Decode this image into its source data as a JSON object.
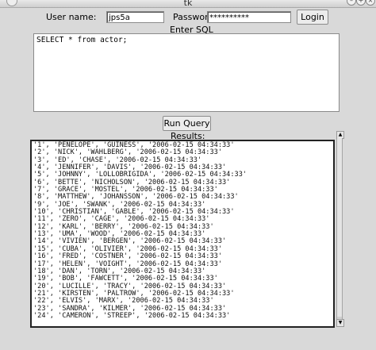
{
  "window": {
    "title": "tk"
  },
  "login": {
    "user_label": "User name:",
    "user_value": "jps5a",
    "password_label": "Password:",
    "password_value": "**********",
    "login_button": "Login"
  },
  "sql": {
    "label": "Enter SQL",
    "query": "SELECT * from actor;",
    "run_button": "Run Query"
  },
  "results": {
    "label": "Results:",
    "rows": [
      "'1', 'PENELOPE', 'GUINESS', '2006-02-15 04:34:33'",
      "'2', 'NICK', 'WAHLBERG', '2006-02-15 04:34:33'",
      "'3', 'ED', 'CHASE', '2006-02-15 04:34:33'",
      "'4', 'JENNIFER', 'DAVIS', '2006-02-15 04:34:33'",
      "'5', 'JOHNNY', 'LOLLOBRIGIDA', '2006-02-15 04:34:33'",
      "'6', 'BETTE', 'NICHOLSON', '2006-02-15 04:34:33'",
      "'7', 'GRACE', 'MOSTEL', '2006-02-15 04:34:33'",
      "'8', 'MATTHEW', 'JOHANSSON', '2006-02-15 04:34:33'",
      "'9', 'JOE', 'SWANK', '2006-02-15 04:34:33'",
      "'10', 'CHRISTIAN', 'GABLE', '2006-02-15 04:34:33'",
      "'11', 'ZERO', 'CAGE', '2006-02-15 04:34:33'",
      "'12', 'KARL', 'BERRY', '2006-02-15 04:34:33'",
      "'13', 'UMA', 'WOOD', '2006-02-15 04:34:33'",
      "'14', 'VIVIEN', 'BERGEN', '2006-02-15 04:34:33'",
      "'15', 'CUBA', 'OLIVIER', '2006-02-15 04:34:33'",
      "'16', 'FRED', 'COSTNER', '2006-02-15 04:34:33'",
      "'17', 'HELEN', 'VOIGHT', '2006-02-15 04:34:33'",
      "'18', 'DAN', 'TORN', '2006-02-15 04:34:33'",
      "'19', 'BOB', 'FAWCETT', '2006-02-15 04:34:33'",
      "'20', 'LUCILLE', 'TRACY', '2006-02-15 04:34:33'",
      "'21', 'KIRSTEN', 'PALTROW', '2006-02-15 04:34:33'",
      "'22', 'ELVIS', 'MARX', '2006-02-15 04:34:33'",
      "'23', 'SANDRA', 'KILMER', '2006-02-15 04:34:33'",
      "'24', 'CAMERON', 'STREEP', '2006-02-15 04:34:33'"
    ]
  }
}
